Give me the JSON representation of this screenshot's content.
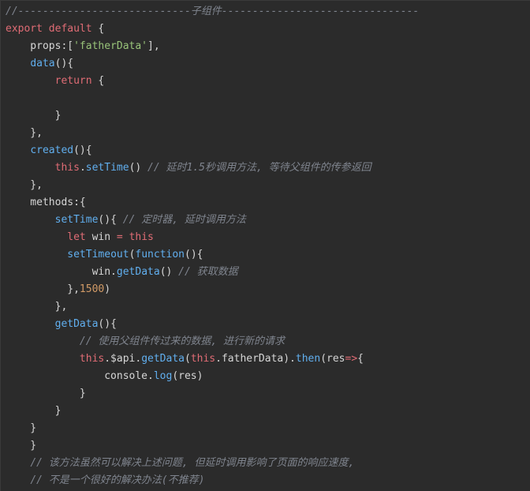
{
  "colors": {
    "background": "#2b2b2b",
    "default_text": "#d6d6d6",
    "keyword": "#e06c75",
    "function": "#61afef",
    "string": "#98c379",
    "number": "#d19a66",
    "comment": "#7f848e"
  },
  "code_lines": [
    [
      {
        "t": "//----------------------------子组件--------------------------------",
        "c": "cm"
      }
    ],
    [
      {
        "t": "export",
        "c": "kw"
      },
      {
        "t": " "
      },
      {
        "t": "default",
        "c": "kw"
      },
      {
        "t": " {"
      }
    ],
    [
      {
        "t": "    props:["
      },
      {
        "t": "'fatherData'",
        "c": "str"
      },
      {
        "t": "],"
      }
    ],
    [
      {
        "t": "    "
      },
      {
        "t": "data",
        "c": "fn"
      },
      {
        "t": "(){"
      }
    ],
    [
      {
        "t": "        "
      },
      {
        "t": "return",
        "c": "kw"
      },
      {
        "t": " {"
      }
    ],
    [
      {
        "t": ""
      }
    ],
    [
      {
        "t": "        }"
      }
    ],
    [
      {
        "t": "    },"
      }
    ],
    [
      {
        "t": "    "
      },
      {
        "t": "created",
        "c": "fn"
      },
      {
        "t": "(){"
      }
    ],
    [
      {
        "t": "        "
      },
      {
        "t": "this",
        "c": "kw"
      },
      {
        "t": "."
      },
      {
        "t": "setTime",
        "c": "fn"
      },
      {
        "t": "() "
      },
      {
        "t": "// 延时1.5秒调用方法, 等待父组件的传参返回",
        "c": "cm"
      }
    ],
    [
      {
        "t": "    },"
      }
    ],
    [
      {
        "t": "    methods:{"
      }
    ],
    [
      {
        "t": "        "
      },
      {
        "t": "setTime",
        "c": "fn"
      },
      {
        "t": "(){ "
      },
      {
        "t": "// 定时器, 延时调用方法",
        "c": "cm"
      }
    ],
    [
      {
        "t": "          "
      },
      {
        "t": "let",
        "c": "kw"
      },
      {
        "t": " win "
      },
      {
        "t": "=",
        "c": "kw"
      },
      {
        "t": " "
      },
      {
        "t": "this",
        "c": "kw"
      }
    ],
    [
      {
        "t": "          "
      },
      {
        "t": "setTimeout",
        "c": "fn"
      },
      {
        "t": "("
      },
      {
        "t": "function",
        "c": "fn"
      },
      {
        "t": "(){"
      }
    ],
    [
      {
        "t": "              win."
      },
      {
        "t": "getData",
        "c": "fn"
      },
      {
        "t": "() "
      },
      {
        "t": "// 获取数据",
        "c": "cm"
      }
    ],
    [
      {
        "t": "          },"
      },
      {
        "t": "1500",
        "c": "num"
      },
      {
        "t": ")"
      }
    ],
    [
      {
        "t": "        },"
      }
    ],
    [
      {
        "t": "        "
      },
      {
        "t": "getData",
        "c": "fn"
      },
      {
        "t": "(){"
      }
    ],
    [
      {
        "t": "            "
      },
      {
        "t": "// 使用父组件传过来的数据, 进行新的请求",
        "c": "cm"
      }
    ],
    [
      {
        "t": "            "
      },
      {
        "t": "this",
        "c": "kw"
      },
      {
        "t": ".$api."
      },
      {
        "t": "getData",
        "c": "fn"
      },
      {
        "t": "("
      },
      {
        "t": "this",
        "c": "kw"
      },
      {
        "t": ".fatherData)."
      },
      {
        "t": "then",
        "c": "fn"
      },
      {
        "t": "(res"
      },
      {
        "t": "=>",
        "c": "kw"
      },
      {
        "t": "{"
      }
    ],
    [
      {
        "t": "                console."
      },
      {
        "t": "log",
        "c": "fn"
      },
      {
        "t": "(res)"
      }
    ],
    [
      {
        "t": "            }"
      }
    ],
    [
      {
        "t": "        }"
      }
    ],
    [
      {
        "t": "    }"
      }
    ],
    [
      {
        "t": "    }"
      }
    ],
    [
      {
        "t": "    "
      },
      {
        "t": "// 该方法虽然可以解决上述问题, 但延时调用影响了页面的响应速度,",
        "c": "cm"
      }
    ],
    [
      {
        "t": "    "
      },
      {
        "t": "// 不是一个很好的解决办法(不推荐)",
        "c": "cm"
      }
    ]
  ]
}
